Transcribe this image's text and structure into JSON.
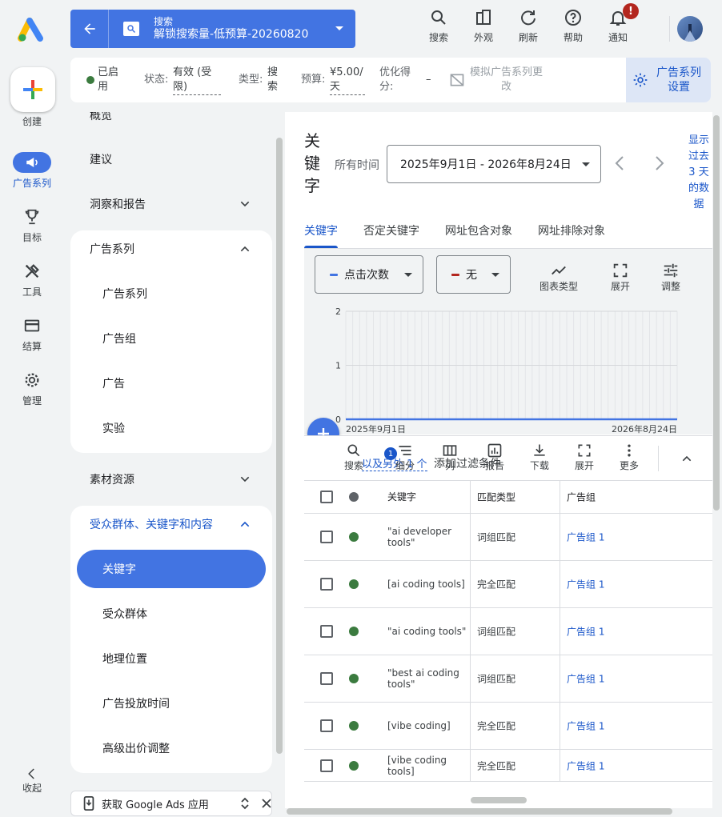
{
  "top": {
    "campaign_type": "搜索",
    "campaign_name": "解锁搜索量-低预算-20260820",
    "actions": [
      {
        "label": "搜索",
        "icon": "search-icon"
      },
      {
        "label": "外观",
        "icon": "appearance-icon"
      },
      {
        "label": "刷新",
        "icon": "refresh-icon"
      },
      {
        "label": "帮助",
        "icon": "help-icon"
      },
      {
        "label": "通知",
        "icon": "bell-icon"
      }
    ],
    "notification_badge": "!"
  },
  "status": {
    "enabled": "已启用",
    "state_label": "状态:",
    "state_value": "有效 (受限)",
    "type_label": "类型:",
    "type_value": "搜索",
    "budget_label": "预算:",
    "budget_value": "¥5.00/天",
    "score_label": "优化得分:",
    "score_value": "–",
    "simulate": "模拟广告系列更改",
    "settings": "广告系列设置"
  },
  "rail": {
    "create": "创建",
    "items": [
      {
        "label": "广告系列",
        "icon": "megaphone-icon"
      },
      {
        "label": "目标",
        "icon": "trophy-icon"
      },
      {
        "label": "工具",
        "icon": "tools-icon"
      },
      {
        "label": "结算",
        "icon": "credit-card-icon"
      },
      {
        "label": "管理",
        "icon": "gear-icon"
      }
    ],
    "collapse": "收起"
  },
  "nav": {
    "overview": "概览",
    "recommendations": "建议",
    "insights": "洞察和报告",
    "campaigns_group": "广告系列",
    "campaigns_sub": [
      "广告系列",
      "广告组",
      "广告",
      "实验"
    ],
    "assets": "素材资源",
    "audience_group": "受众群体、关键字和内容",
    "audience_sub": [
      "关键字",
      "受众群体",
      "地理位置",
      "广告投放时间",
      "高级出价调整"
    ]
  },
  "app_banner": "获取 Google Ads 应用",
  "main": {
    "title": "关键字",
    "all_time": "所有时间",
    "date_range": "2025年9月1日 - 2026年8月24日",
    "show_link": "显示过去 3 天的数据",
    "tabs": [
      "关键字",
      "否定关键字",
      "网址包含对象",
      "网址排除对象"
    ],
    "metric1": "点击次数",
    "metric2": "无",
    "chart_tools": [
      "图表类型",
      "展开",
      "调整"
    ],
    "toolbar": {
      "filter_link": "以及另外 1 个",
      "add_filter": "添加过滤条件",
      "filter_badge": "1",
      "tools": [
        "搜索",
        "细分",
        "列",
        "报告",
        "下载",
        "展开",
        "更多"
      ]
    },
    "columns": [
      "关键字",
      "匹配类型",
      "广告组"
    ],
    "rows": [
      {
        "keyword": "\"ai developer tools\"",
        "match": "词组匹配",
        "group": "广告组 1"
      },
      {
        "keyword": "[ai coding tools]",
        "match": "完全匹配",
        "group": "广告组 1"
      },
      {
        "keyword": "\"ai coding tools\"",
        "match": "词组匹配",
        "group": "广告组 1"
      },
      {
        "keyword": "\"best ai coding tools\"",
        "match": "词组匹配",
        "group": "广告组 1"
      },
      {
        "keyword": "[vibe coding]",
        "match": "完全匹配",
        "group": "广告组 1"
      },
      {
        "keyword": "[vibe coding tools]",
        "match": "完全匹配",
        "group": "广告组 1"
      }
    ]
  },
  "chart_data": {
    "type": "line",
    "x": [
      "2025年9月1日",
      "2026年8月24日"
    ],
    "series": [
      {
        "name": "点击次数",
        "values": [
          0,
          0
        ]
      }
    ],
    "yticks": [
      "0",
      "1",
      "2"
    ],
    "ylim": [
      0,
      2
    ],
    "xlabel": "",
    "ylabel": "",
    "colors": {
      "series1": "#4274e2",
      "series2": "#b3261e"
    }
  }
}
